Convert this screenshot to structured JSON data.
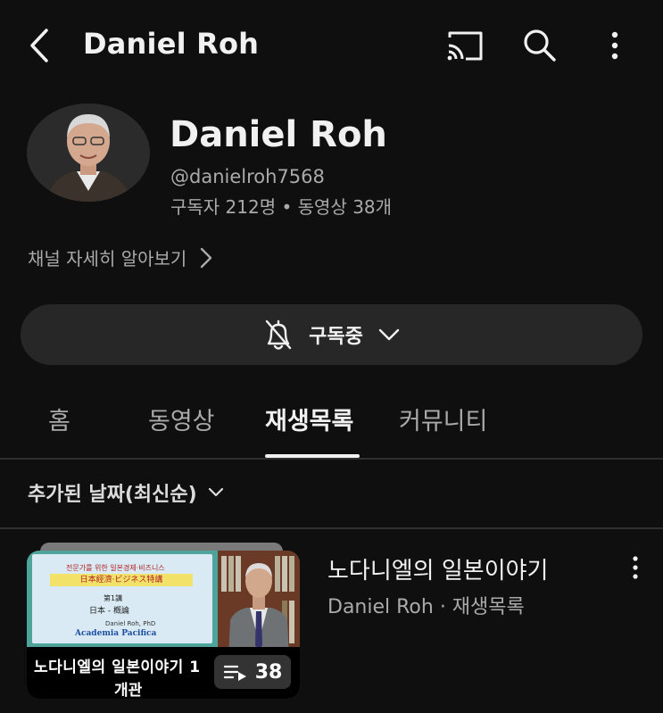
{
  "header": {
    "title": "Daniel Roh",
    "back_icon": "chevron-left-icon",
    "cast_icon": "cast-icon",
    "search_icon": "search-icon",
    "more_icon": "more-vertical-icon"
  },
  "channel": {
    "name": "Daniel Roh",
    "handle": "@danielroh7568",
    "stats": "구독자 212명 • 동영상 38개",
    "about_label": "채널 자세히 알아보기"
  },
  "subscribe": {
    "label": "구독중",
    "bell_icon": "bell-off-icon",
    "chevron_icon": "chevron-down-icon"
  },
  "tabs": [
    {
      "label": "홈",
      "active": false
    },
    {
      "label": "동영상",
      "active": false
    },
    {
      "label": "재생목록",
      "active": true
    },
    {
      "label": "커뮤니티",
      "active": false
    }
  ],
  "sort": {
    "label": "추가된 날짜(최신순)"
  },
  "playlist": {
    "title": "노다니엘의 일본이야기",
    "meta": "Daniel Roh · 재생목록",
    "video_count": "38",
    "thumbnail_caption_line1": "노다니엘의 일본이야기 1",
    "thumbnail_caption_line2": "개관",
    "slide": {
      "line1": "전문가를 위한 일본경제·비즈니스",
      "line2": "日本經濟·ビジネス特講",
      "line3": "第1講",
      "line4": "日本 - 槪論",
      "line5": "Daniel Roh, PhD",
      "line6": "Academia Pacifica"
    }
  },
  "colors": {
    "background": "#0f0f0f",
    "text_primary": "#f1f1f1",
    "text_secondary": "#aaaaaa",
    "pill": "#272727"
  }
}
